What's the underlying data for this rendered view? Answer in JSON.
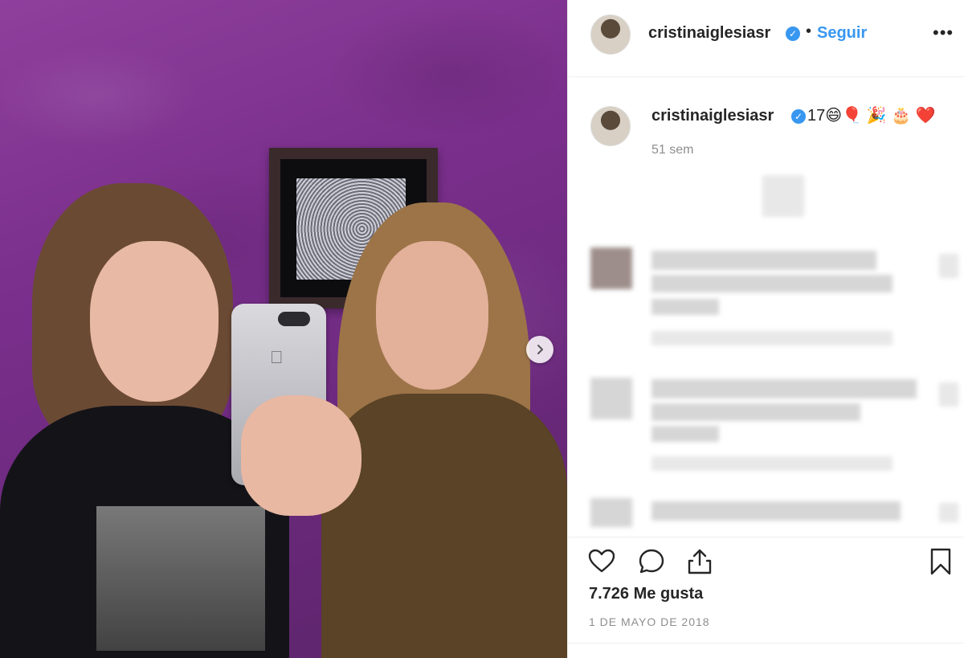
{
  "post": {
    "username": "cristinaiglesiasr",
    "verified_badge": "✓",
    "separator": "•",
    "follow_label": "Seguir",
    "more_label": "•••",
    "caption": "17😄🎈 🎉 🎂 ❤️",
    "time_ago": "51 sem",
    "likes": "7.726 Me gusta",
    "date": "1 DE MAYO DE 2018"
  },
  "colors": {
    "accent": "#3897f0",
    "text": "#262626",
    "muted": "#8e8e8e",
    "wall": "#7a2f8c"
  },
  "icons": {
    "next": "chevron-right-icon",
    "like": "heart-icon",
    "comment": "comment-icon",
    "share": "share-icon",
    "save": "bookmark-icon"
  }
}
